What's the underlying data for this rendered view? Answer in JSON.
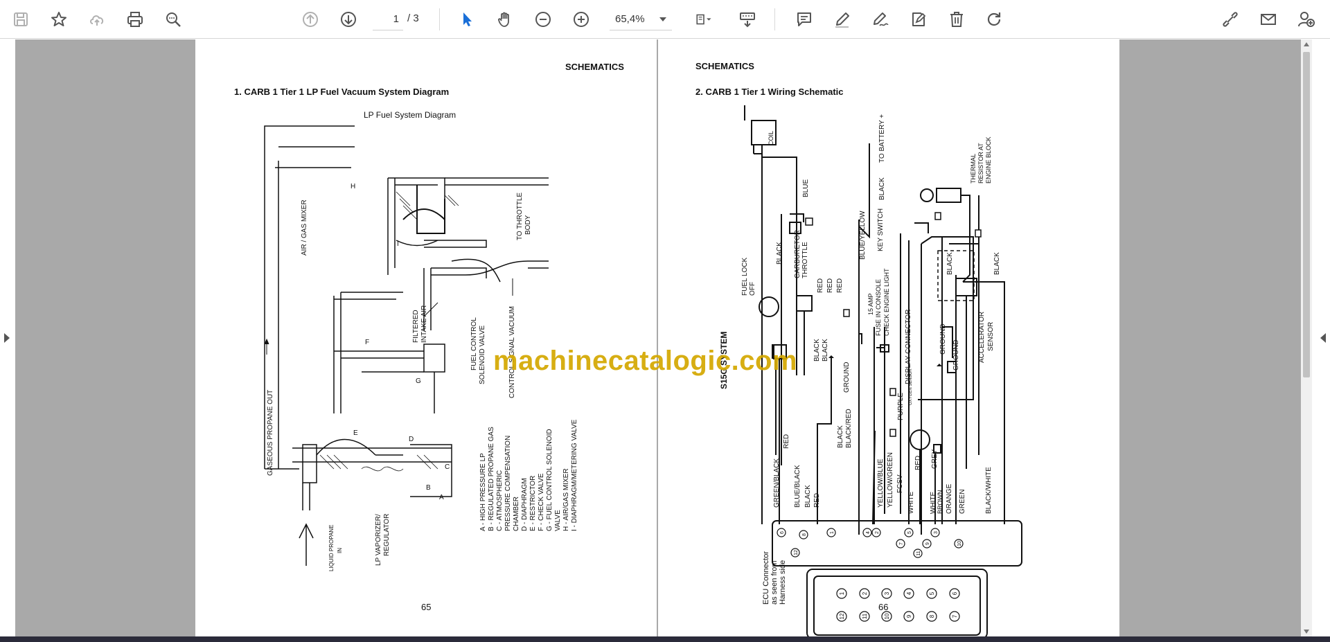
{
  "toolbar": {
    "page_current": "1",
    "page_total": "/ 3",
    "zoom": "65,4%",
    "icons": [
      "save-icon",
      "star-icon",
      "cloud-upload-icon",
      "print-icon",
      "zoom-search-icon",
      "page-up-icon",
      "page-down-icon",
      "select-cursor-icon",
      "hand-tool-icon",
      "zoom-out-icon",
      "zoom-in-icon",
      "fit-page-icon",
      "keyboard-scroll-icon",
      "comment-icon",
      "pen-icon",
      "sign-icon",
      "stamp-icon",
      "trash-icon",
      "rotate-icon",
      "share-link-icon",
      "email-icon",
      "add-user-icon"
    ]
  },
  "left_page": {
    "header": "SCHEMATICS",
    "heading": "1. CARB 1 Tier 1 LP Fuel Vacuum System Diagram",
    "subtitle": "LP Fuel System Diagram",
    "page_number": "65",
    "labels": {
      "h": "H",
      "air_gas_mixer": "AIR / GAS MIXER",
      "to_throttle": "TO THROTTLE",
      "body": "BODY",
      "filtered": "FILTERED",
      "intake_air": "INTAKE AIR",
      "fuel_control": "FUEL CONTROL",
      "solenoid_valve": "SOLENOID VALVE",
      "control_signal": "CONTROL SIGNAL VACUUM",
      "gaseous": "GASEOUS PROPANE OUT",
      "lp_vaporizer": "LP VAPORIZER/",
      "regulator": "REGULATOR",
      "liquid_propane": "LIQUID PROPANE",
      "in": "IN",
      "a": "A",
      "b": "B",
      "c": "C",
      "d": "D",
      "e": "E",
      "f": "F",
      "g": "G",
      "i": "I"
    },
    "legend": [
      "A  -  HIGH PRESSURE LP",
      "B  -  REGULATED PROPANE GAS",
      "C  -  ATMOSPHERIC",
      "        PRESSURE COMPENSATION",
      "        CHAMBER",
      "D  -  DIAPHRAGM",
      "E  -  RESTRICTOR",
      "F  -  CHECK VALVE",
      "G  -  FUEL CONTROL SOLENOID",
      "        VALVE",
      "H  -  AIR/GAS MIXER",
      "I  -  DIAPHRAGM/METERING VALVE"
    ]
  },
  "right_page": {
    "header": "SCHEMATICS",
    "heading": "2. CARB 1 Tier 1 Wiring Schematic",
    "page_number": "66",
    "system_label": "S15G SYSTEM",
    "labels": {
      "coil": "COIL",
      "blue": "BLUE",
      "to_battery": "TO BATTERY +",
      "black": "BLACK",
      "key_switch": "KEY SWITCH",
      "blue_yellow": "BLUE/YELLOW",
      "thermal1": "THERMAL",
      "thermal2": "RESISTOR AT",
      "thermal3": "ENGINE BLOCK",
      "carburetor": "CARBURETOR",
      "throttle": "THROTTLE",
      "fuel_lock": "FUEL LOCK",
      "off": "OFF",
      "red": "RED",
      "amp": "15 AMP",
      "fuse": "FUSE IN CONSOLE",
      "check_engine": "CHECK ENGINE LIGHT",
      "display_connector": "DISPLAY CONNECTOR",
      "ground": "GROUND",
      "purple": "PURPLE",
      "oxygen_sensor": "OXYGEN SENSOR",
      "accelerator": "ACCELERATOR",
      "sensor": "SENSOR",
      "black_red": "BLACK/RED",
      "green_black": "GREEN/BLACK",
      "blue_black": "BLUE/BLACK",
      "yellow_blue": "YELLOW/BLUE",
      "yellow_green": "YELLOW/GREEN",
      "fcsv": "FCSV",
      "white": "WHITE",
      "grey": "GREY",
      "brown": "BROWN",
      "orange": "ORANGE",
      "green": "GREEN",
      "black_white": "BLACK/WHITE",
      "ecu1": "ECU Connector",
      "ecu2": "as seen from",
      "ecu3": "Harness side"
    },
    "top_pins": [
      "6",
      "12",
      "8",
      "1",
      "4",
      "2",
      "7",
      "5",
      "11",
      "9",
      "3",
      "10"
    ],
    "connector_top": [
      "1",
      "2",
      "3",
      "4",
      "5",
      "6"
    ],
    "connector_bottom": [
      "12",
      "11",
      "10",
      "9",
      "8",
      "7"
    ]
  },
  "watermark": "machinecatalogic.com"
}
